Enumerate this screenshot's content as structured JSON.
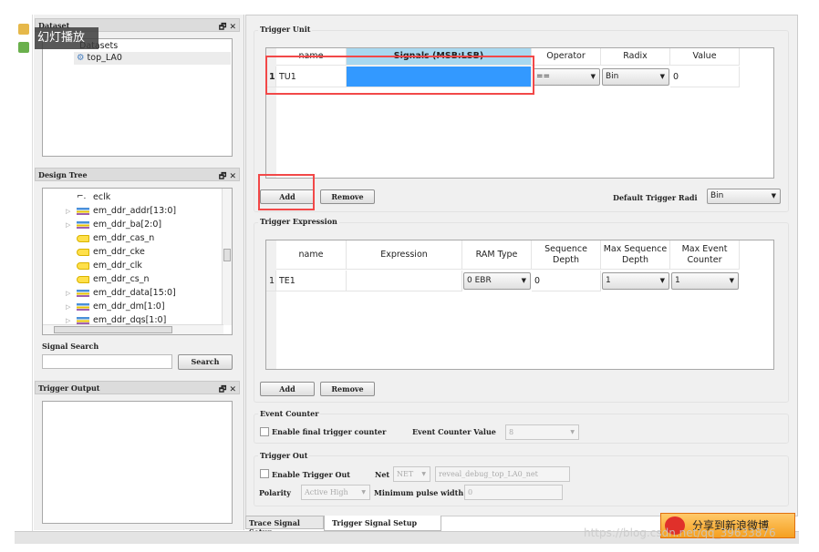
{
  "overlay": {
    "slideshow_label": "幻灯播放"
  },
  "dataset": {
    "title": "Dataset",
    "root": "Datasets",
    "items": [
      "top_LA0"
    ]
  },
  "design_tree": {
    "title": "Design Tree",
    "items": [
      {
        "label": "eclk",
        "type": "clock",
        "expandable": false
      },
      {
        "label": "em_ddr_addr[13:0]",
        "type": "bus",
        "expandable": true
      },
      {
        "label": "em_ddr_ba[2:0]",
        "type": "bus",
        "expandable": true
      },
      {
        "label": "em_ddr_cas_n",
        "type": "port",
        "expandable": false
      },
      {
        "label": "em_ddr_cke",
        "type": "port",
        "expandable": false
      },
      {
        "label": "em_ddr_clk",
        "type": "port",
        "expandable": false
      },
      {
        "label": "em_ddr_cs_n",
        "type": "port",
        "expandable": false
      },
      {
        "label": "em_ddr_data[15:0]",
        "type": "bus",
        "expandable": true
      },
      {
        "label": "em_ddr_dm[1:0]",
        "type": "bus",
        "expandable": true
      },
      {
        "label": "em_ddr_dqs[1:0]",
        "type": "bus",
        "expandable": true
      }
    ]
  },
  "signal_search": {
    "label": "Signal Search",
    "value": "",
    "button": "Search"
  },
  "trigger_output": {
    "title": "Trigger Output"
  },
  "trigger_unit": {
    "title": "Trigger Unit",
    "columns": [
      "name",
      "Signals (MSB:LSB)",
      "Operator",
      "Radix",
      "Value"
    ],
    "rows": [
      {
        "index": "1",
        "name": "TU1",
        "signals": "",
        "operator": "==",
        "radix": "Bin",
        "value": "0"
      }
    ],
    "add": "Add",
    "remove": "Remove",
    "default_radix_label": "Default Trigger Radi",
    "default_radix": "Bin"
  },
  "trigger_expression": {
    "title": "Trigger Expression",
    "columns": [
      "name",
      "Expression",
      "RAM Type",
      "Sequence Depth",
      "Max Sequence Depth",
      "Max Event Counter"
    ],
    "rows": [
      {
        "index": "1",
        "name": "TE1",
        "expression": "",
        "ram_type": "0 EBR",
        "sequence_depth": "0",
        "max_sequence_depth": "1",
        "max_event_counter": "1"
      }
    ],
    "add": "Add",
    "remove": "Remove"
  },
  "event_counter": {
    "title": "Event Counter",
    "enable_label": "Enable final trigger counter",
    "enabled": false,
    "value_label": "Event Counter Value",
    "value": "8"
  },
  "trigger_out": {
    "title": "Trigger Out",
    "enable_label": "Enable Trigger Out",
    "enabled": false,
    "net_label": "Net",
    "net_type": "NET",
    "net_value": "reveal_debug_top_LA0_net",
    "polarity_label": "Polarity",
    "polarity": "Active High",
    "min_pulse_label": "Minimum pulse width",
    "min_pulse": "0"
  },
  "tabs": [
    {
      "label": "Trace Signal Setup",
      "active": false
    },
    {
      "label": "Trigger Signal Setup",
      "active": true
    }
  ],
  "share": {
    "label": "分享到新浪微博"
  },
  "watermark": "https://blog.csdn.net/qq_39633876",
  "colors": {
    "selection": "#3399ff",
    "header_selected": "#a8d8f0",
    "highlight_box": "#f24848"
  }
}
